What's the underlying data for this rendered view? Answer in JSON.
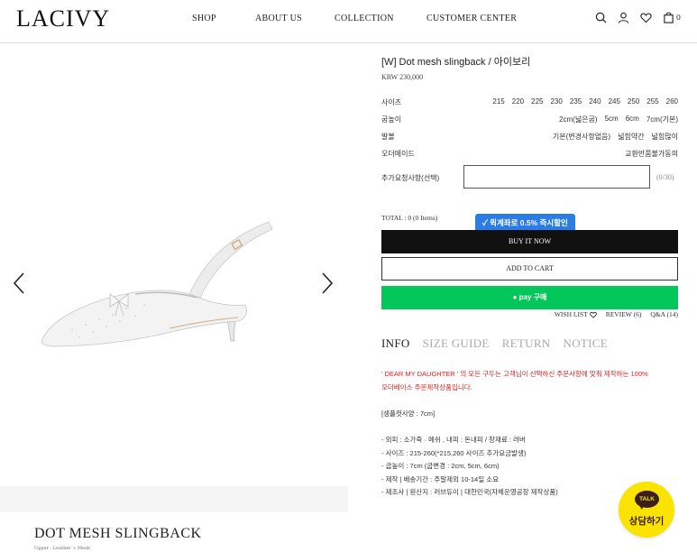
{
  "header": {
    "logo": "LACIVY",
    "nav": [
      {
        "label": "SHOP"
      },
      {
        "label": "ABOUT US"
      },
      {
        "label": "COLLECTION"
      },
      {
        "label": "CUSTOMER CENTER"
      }
    ],
    "icons": [
      "search-icon",
      "user-icon",
      "heart-icon",
      "bag-icon"
    ],
    "cart_count": "0"
  },
  "product_image": {
    "caption_title": "DOT MESH SLINGBACK",
    "caption_sub": "Upper : Leather + Mesh"
  },
  "product": {
    "title": "[W] Dot mesh slingback / 아이보리",
    "price": "KRW 230,000"
  },
  "options": {
    "size": {
      "label": "사이즈",
      "values": [
        "215",
        "220",
        "225",
        "230",
        "235",
        "240",
        "245",
        "250",
        "255",
        "260"
      ]
    },
    "heel": {
      "label": "굽높이",
      "values": [
        "2cm(넓은굽)",
        "5cm",
        "6cm",
        "7cm(기본)"
      ]
    },
    "width": {
      "label": "발볼",
      "values": [
        "기본(변경사항없음)",
        "넓힘약간",
        "넓힘많이"
      ]
    },
    "order": {
      "label": "오더메이드",
      "values": [
        "교환반품불가동의"
      ]
    }
  },
  "request": {
    "label": "추가요청사항(선택)",
    "value": "",
    "count": "(0/30)"
  },
  "total": "TOTAL : 0 (0 Items)",
  "promo": "✓ 퀵계좌로 0.5% 즉시할인",
  "buttons": {
    "buy": "BUY IT NOW",
    "cart": "ADD TO CART",
    "npay": "● pay 구매"
  },
  "sublinks": {
    "wishlist": "WISH LIST",
    "review": "REVIEW (6)",
    "qna": "Q&A (14)"
  },
  "tabs": [
    {
      "label": "INFO"
    },
    {
      "label": "SIZE GUIDE"
    },
    {
      "label": "RETURN"
    },
    {
      "label": "NOTICE"
    }
  ],
  "info": {
    "notice_line1": "' DEAR MY DAUGHTER ' 의 모든 구두는 고객님이 선택하신 주문사항에 맞춰 제작하는 100%",
    "notice_line2": "오더베이스 주문제작상품입니다.",
    "sample": "[샘플컷사양 : 7cm]",
    "details": [
      "- 외피 : 소가죽 · 메쉬 , 내피 : 돈내피 / 창재료 : 러버",
      "- 사이즈 : 215-260(*215,260 사이즈 추가요금발생)",
      "- 굽높이 : 7cm (굽변경 : 2cm, 5cm, 6cm)",
      "- 제작 | 배송기간 : 주말제외 10-14일 소요",
      "- 제조사 | 원산지 : 러브듀이 | 대한민국(자체운영공장 제작상품)"
    ]
  },
  "talk": {
    "bubble": "TALK",
    "label": "상담하기"
  }
}
